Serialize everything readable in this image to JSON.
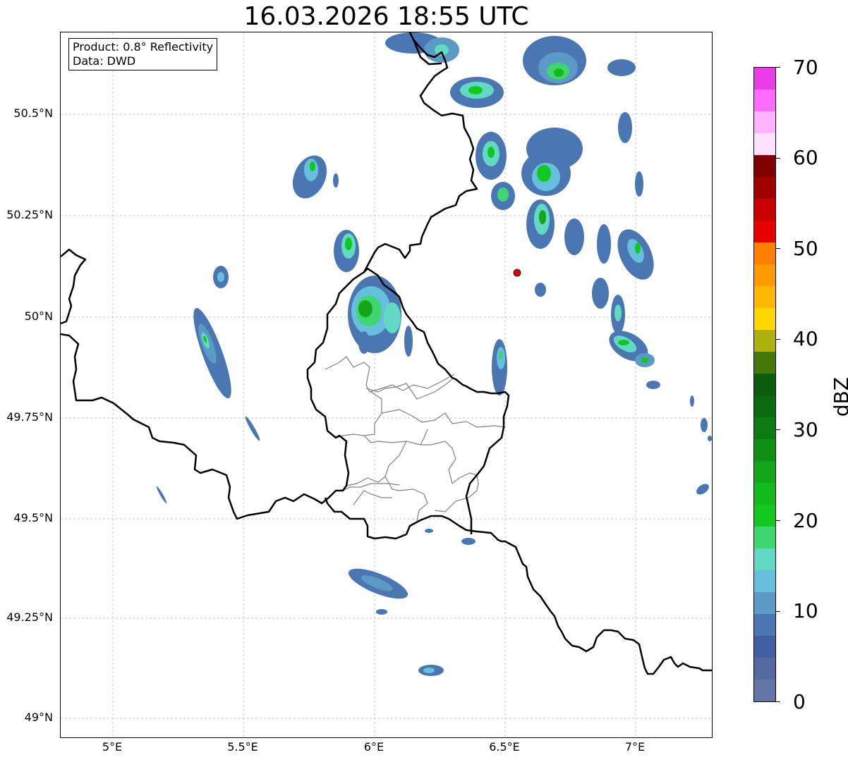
{
  "title": "16.03.2026 18:55 UTC",
  "infobox": {
    "product": "Product: 0.8° Reflectivity",
    "data": "Data: DWD"
  },
  "axes": {
    "lon_ticks": [
      "5°E",
      "5.5°E",
      "6°E",
      "6.5°E",
      "7°E"
    ],
    "lat_ticks": [
      "50.5°N",
      "50.25°N",
      "50°N",
      "49.75°N",
      "49.5°N",
      "49.25°N",
      "49°N"
    ],
    "lon_range": [
      4.8,
      7.3
    ],
    "lat_range": [
      48.95,
      50.7
    ]
  },
  "colorbar": {
    "unit": "dBZ",
    "min": 0,
    "max": 70,
    "tick_labels": [
      "0",
      "10",
      "20",
      "30",
      "40",
      "50",
      "60",
      "70"
    ],
    "colors": [
      "#6475a6",
      "#5369a0",
      "#425ea2",
      "#4a77b1",
      "#5a9ac4",
      "#66bfdc",
      "#62d9c5",
      "#3dd671",
      "#13c81d",
      "#11bb18",
      "#12a618",
      "#108f15",
      "#0c7b11",
      "#0c6a0e",
      "#0b5c0d",
      "#467809",
      "#b0b00a",
      "#ffd700",
      "#ffb800",
      "#ff9a00",
      "#ff7f00",
      "#e60000",
      "#c80000",
      "#a00000",
      "#800000",
      "#ffe1ff",
      "#ffb4ff",
      "#ff6bff",
      "#ea3cea"
    ]
  },
  "radar_site": {
    "lon": 6.548,
    "lat": 50.11,
    "color": "#e60000"
  },
  "colors": {
    "border": "#000000",
    "admin_border": "#808080",
    "grid": "#b0b0b0"
  }
}
